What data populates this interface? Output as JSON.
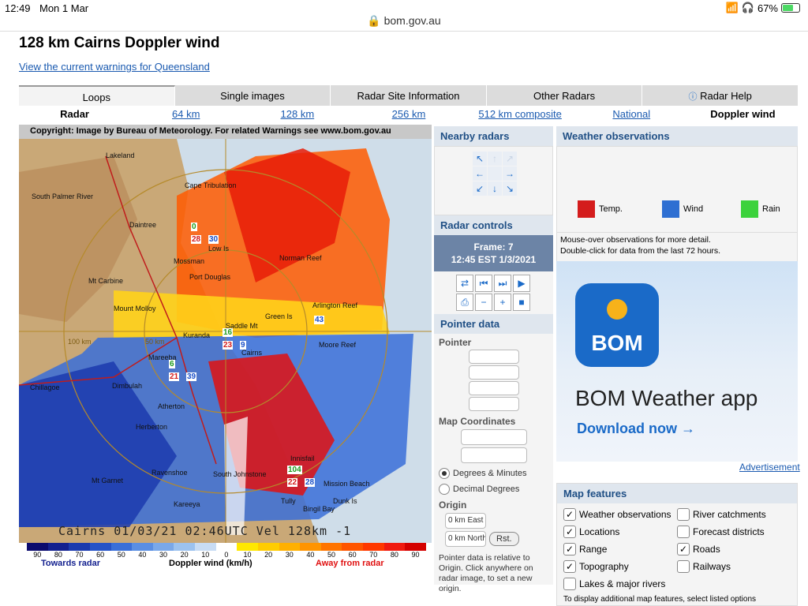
{
  "status": {
    "time": "12:49",
    "date": "Mon 1 Mar",
    "battery": "67%",
    "battery_level": 0.67
  },
  "browser": {
    "url": "bom.gov.au",
    "lock_icon": "lock-icon"
  },
  "page": {
    "title": "128 km Cairns Doppler wind",
    "warnings_link": "View the current warnings for Queensland"
  },
  "tabs": [
    {
      "label": "Loops",
      "active": true
    },
    {
      "label": "Single images"
    },
    {
      "label": "Radar Site Information"
    },
    {
      "label": "Other Radars"
    },
    {
      "label": "Radar Help",
      "icon": "info-icon"
    }
  ],
  "subnav": {
    "radar": "Radar",
    "r64": "64 km",
    "r128": "128 km",
    "r256": "256 km",
    "r512": "512 km composite",
    "national": "National",
    "doppler": "Doppler wind"
  },
  "radar": {
    "copyright": "Copyright: Image by Bureau of Meteorology.  For related Warnings see www.bom.gov.au",
    "footer": "Cairns   01/03/21 02:46UTC  Vel 128km -1",
    "places": [
      "Lakeland",
      "Cape Tribulation",
      "South Palmer River",
      "Daintree",
      "Mossman",
      "Low Is",
      "Port Douglas",
      "Norman Reef",
      "Mt Carbine",
      "Mount Molloy",
      "Arlington Reef",
      "Green Is",
      "Saddle Mt",
      "Kuranda",
      "Cairns",
      "Moore Reef",
      "Mareeba",
      "Chillagoe",
      "Dimbulah",
      "Atherton",
      "Herberton",
      "Innisfail",
      "Mt Garnet",
      "Ravenshoe",
      "South Johnstone",
      "Kareeya",
      "Mission Beach",
      "Tully",
      "Dunk Is",
      "Bingil Bay"
    ],
    "range_labels": [
      "100 km",
      "50 km"
    ],
    "obs": [
      {
        "temp": "28",
        "wind": "30",
        "rain": "0"
      },
      {
        "temp": "",
        "wind": "43",
        "rain": ""
      },
      {
        "temp": "23",
        "wind": "9",
        "rain": "16"
      },
      {
        "temp": "21",
        "wind": "39",
        "rain": "6"
      },
      {
        "temp": "22",
        "wind": "28",
        "rain": "104"
      }
    ]
  },
  "legend": {
    "numbers": [
      "90",
      "80",
      "70",
      "60",
      "50",
      "40",
      "30",
      "20",
      "10",
      "0",
      "10",
      "20",
      "30",
      "40",
      "50",
      "60",
      "70",
      "80",
      "90"
    ],
    "colors": [
      "#0b0b6e",
      "#13208f",
      "#1b3aae",
      "#2553c7",
      "#3a6fd8",
      "#5a8ee3",
      "#7aa8e9",
      "#9cc2ef",
      "#c8dcf4",
      "#ffffff",
      "#ffe800",
      "#ffcc00",
      "#ffb000",
      "#ff9400",
      "#ff7400",
      "#ff5500",
      "#ff3800",
      "#f01a10",
      "#d40000"
    ],
    "towards": "Towards radar",
    "title": "Doppler wind (km/h)",
    "away": "Away from radar"
  },
  "nearby": {
    "title": "Nearby radars"
  },
  "controls": {
    "title": "Radar controls",
    "frame": "Frame: 7",
    "time": "12:45 EST 1/3/2021"
  },
  "pointer": {
    "title": "Pointer data",
    "pointer_label": "Pointer",
    "map_coords_label": "Map Coordinates",
    "opt1": "Degrees & Minutes",
    "opt2": "Decimal Degrees",
    "origin_label": "Origin",
    "origin_e": "0 km East",
    "origin_n": "0 km North",
    "reset": "Rst.",
    "note": "Pointer data is relative to Origin. Click anywhere on radar image, to set a new origin."
  },
  "observations": {
    "title": "Weather observations",
    "temp": "Temp.",
    "wind": "Wind",
    "rain": "Rain",
    "temp_color": "#d41c1c",
    "wind_color": "#2e6fd2",
    "rain_color": "#3cd23c",
    "note1": "Mouse-over observations for more detail.",
    "note2": "Double-click for data from the last 72 hours."
  },
  "ad": {
    "icon_text": "BOM",
    "headline": "BOM Weather app",
    "cta": "Download now →",
    "advertisement": "Advertisement"
  },
  "map_features": {
    "title": "Map features",
    "items": [
      {
        "label": "Weather observations",
        "checked": true
      },
      {
        "label": "River catchments",
        "checked": false
      },
      {
        "label": "Locations",
        "checked": true
      },
      {
        "label": "Forecast districts",
        "checked": false
      },
      {
        "label": "Range",
        "checked": true
      },
      {
        "label": "Roads",
        "checked": true
      },
      {
        "label": "Topography",
        "checked": true
      },
      {
        "label": "Railways",
        "checked": false
      },
      {
        "label": "Lakes & major rivers",
        "checked": false
      }
    ],
    "tail": "To display additional map features, select listed options"
  }
}
